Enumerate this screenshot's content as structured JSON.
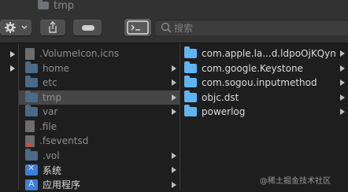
{
  "window": {
    "title": "tmp"
  },
  "toolbar": {
    "gear": "gear-icon",
    "share": "share-icon",
    "tag": "tag-icon",
    "terminal": "terminal-icon",
    "search_placeholder": "搜索"
  },
  "column2": {
    "items": [
      {
        "label": ".VolumeIcon.icns",
        "icon": "file-icon",
        "dim": true
      },
      {
        "label": "home",
        "icon": "folder-icon",
        "dim": true,
        "chevron": true
      },
      {
        "label": "etc",
        "icon": "folder-icon",
        "dim": true,
        "chevron": true
      },
      {
        "label": "tmp",
        "icon": "folder-icon",
        "dim": true,
        "chevron": true,
        "selected": true
      },
      {
        "label": "var",
        "icon": "folder-icon",
        "dim": true,
        "chevron": true
      },
      {
        "label": ".file",
        "icon": "file-icon",
        "dim": true
      },
      {
        "label": ".fseventsd",
        "icon": "file-icon",
        "dim": true,
        "red": true
      },
      {
        "label": ".vol",
        "icon": "folder-icon",
        "dim": true,
        "chevron": true
      },
      {
        "label": "系统",
        "icon": "system-icon",
        "chevron": true
      },
      {
        "label": "应用程序",
        "icon": "applications-icon",
        "chevron": true
      }
    ]
  },
  "column3": {
    "items": [
      {
        "label": "com.apple.la...d.ldpoOjKQyn",
        "chevron": true
      },
      {
        "label": "com.google.Keystone",
        "chevron": true
      },
      {
        "label": "com.sogou.inputmethod",
        "chevron": true
      },
      {
        "label": "objc.dst",
        "chevron": true
      },
      {
        "label": "powerlog",
        "chevron": true
      }
    ]
  },
  "watermark": "@稀土掘金技术社区"
}
